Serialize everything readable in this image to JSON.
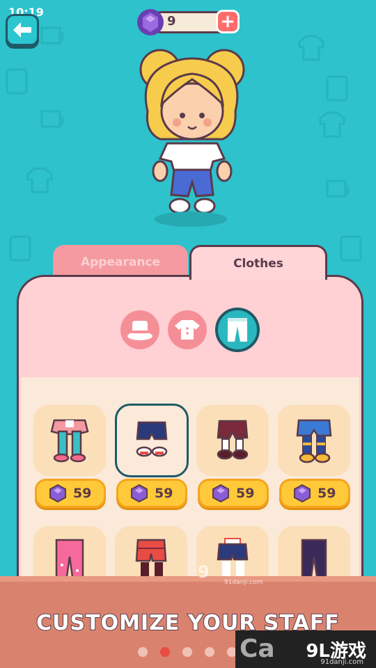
{
  "status": {
    "time": "10:19"
  },
  "currency": {
    "gem_count": "9"
  },
  "tabs": [
    {
      "label": "Appearance",
      "active": false
    },
    {
      "label": "Clothes",
      "active": true
    }
  ],
  "categories": [
    {
      "icon": "hat-icon",
      "active": false
    },
    {
      "icon": "shirt-icon",
      "active": false
    },
    {
      "icon": "pants-icon",
      "active": true
    }
  ],
  "items": [
    {
      "name": "pink-skirt-leggings",
      "price": "59",
      "selected": false
    },
    {
      "name": "navy-shorts",
      "price": "59",
      "selected": true
    },
    {
      "name": "burgundy-shorts-socks",
      "price": "59",
      "selected": false
    },
    {
      "name": "blue-shorts-boots",
      "price": "59",
      "selected": false
    },
    {
      "name": "pink-pants",
      "selected": false
    },
    {
      "name": "plaid-shorts",
      "selected": false
    },
    {
      "name": "navy-red-shorts",
      "selected": false
    },
    {
      "name": "dark-pants",
      "selected": false
    }
  ],
  "footer": {
    "headline": "CUSTOMIZE YOUR STAFF",
    "page_dots": 5,
    "active_dot": 1
  },
  "watermarks": {
    "center_text": "9",
    "center_sub": "91danji.com",
    "corner_text": "9L游戏",
    "corner_sub": "91danji.com"
  },
  "colors": {
    "background": "#2dc2cc",
    "panel": "#ffd0d4",
    "accent_teal": "#2bb7bf",
    "price_yellow": "#ffc93a",
    "outline": "#5a3a4a",
    "gem_purple": "#8a5cd6"
  }
}
